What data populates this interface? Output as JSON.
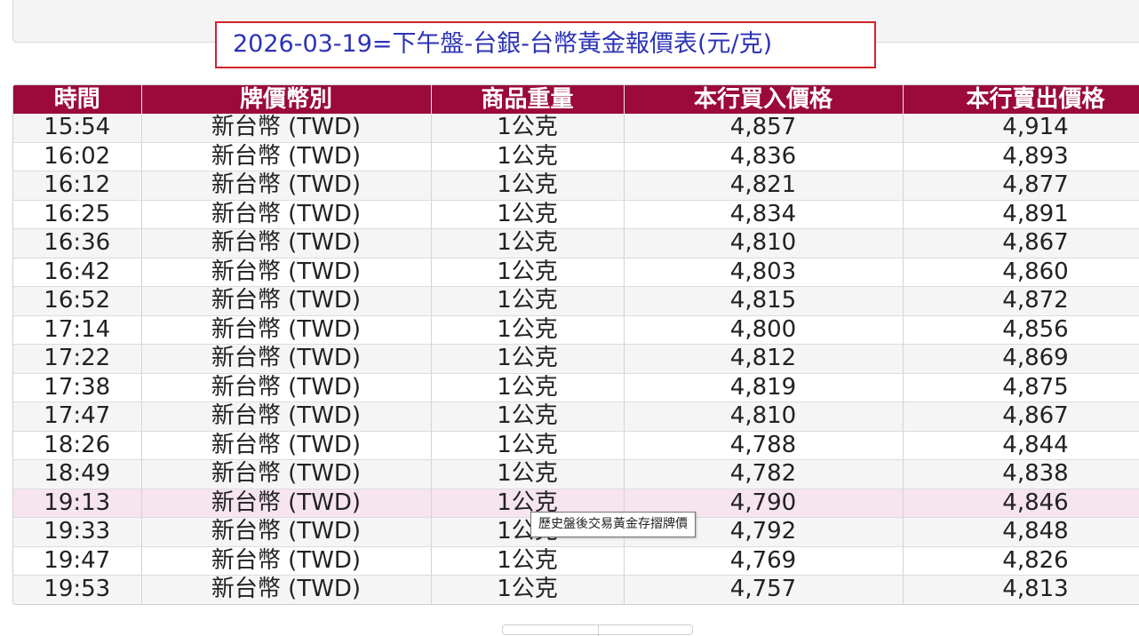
{
  "title": {
    "text": "2026-03-19=下午盤-台銀-台幣黃金報價表(元/克)"
  },
  "table": {
    "headers": [
      "時間",
      "牌價幣別",
      "商品重量",
      "本行買入價格",
      "本行賣出價格"
    ],
    "rows": [
      [
        "15:54",
        "新台幣 (TWD)",
        "1公克",
        "4,857",
        "4,914"
      ],
      [
        "16:02",
        "新台幣 (TWD)",
        "1公克",
        "4,836",
        "4,893"
      ],
      [
        "16:12",
        "新台幣 (TWD)",
        "1公克",
        "4,821",
        "4,877"
      ],
      [
        "16:25",
        "新台幣 (TWD)",
        "1公克",
        "4,834",
        "4,891"
      ],
      [
        "16:36",
        "新台幣 (TWD)",
        "1公克",
        "4,810",
        "4,867"
      ],
      [
        "16:42",
        "新台幣 (TWD)",
        "1公克",
        "4,803",
        "4,860"
      ],
      [
        "16:52",
        "新台幣 (TWD)",
        "1公克",
        "4,815",
        "4,872"
      ],
      [
        "17:14",
        "新台幣 (TWD)",
        "1公克",
        "4,800",
        "4,856"
      ],
      [
        "17:22",
        "新台幣 (TWD)",
        "1公克",
        "4,812",
        "4,869"
      ],
      [
        "17:38",
        "新台幣 (TWD)",
        "1公克",
        "4,819",
        "4,875"
      ],
      [
        "17:47",
        "新台幣 (TWD)",
        "1公克",
        "4,810",
        "4,867"
      ],
      [
        "18:26",
        "新台幣 (TWD)",
        "1公克",
        "4,788",
        "4,844"
      ],
      [
        "18:49",
        "新台幣 (TWD)",
        "1公克",
        "4,782",
        "4,838"
      ],
      [
        "19:13",
        "新台幣 (TWD)",
        "1公克",
        "4,790",
        "4,846"
      ],
      [
        "19:33",
        "新台幣 (TWD)",
        "1公克",
        "4,792",
        "4,848"
      ],
      [
        "19:47",
        "新台幣 (TWD)",
        "1公克",
        "4,769",
        "4,826"
      ],
      [
        "19:53",
        "新台幣 (TWD)",
        "1公克",
        "4,757",
        "4,813"
      ]
    ],
    "hovered_row": 13
  },
  "tooltip": {
    "text": "歷史盤後交易黃金存摺牌價"
  },
  "colors": {
    "header_bg": "#9b0a3b",
    "title_text": "#2c33b4",
    "title_border": "#d2232a",
    "hover_row_bg": "#f6e4ee"
  }
}
